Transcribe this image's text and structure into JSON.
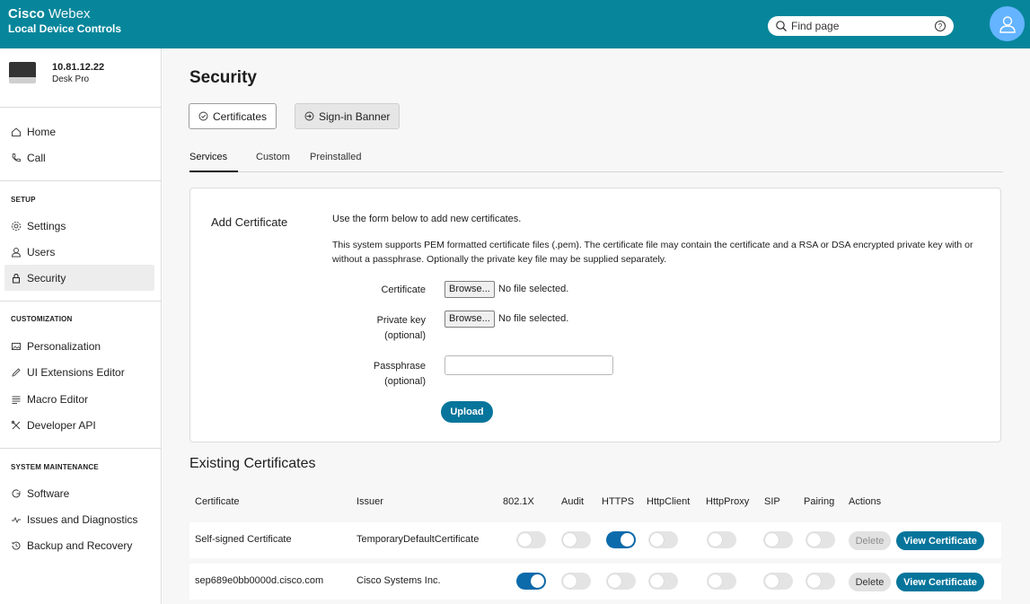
{
  "header": {
    "brand_bold": "Cisco",
    "brand_light": "Webex",
    "subtitle": "Local Device Controls",
    "search_placeholder": "Find page",
    "colors": {
      "bar": "#07869b",
      "avatar": "#64b4ff"
    }
  },
  "device": {
    "ip": "10.81.12.22",
    "model": "Desk Pro"
  },
  "sidebar": {
    "top": [
      {
        "label": "Home",
        "icon": "home-icon"
      },
      {
        "label": "Call",
        "icon": "phone-icon"
      }
    ],
    "sections": [
      {
        "title": "SETUP",
        "items": [
          {
            "label": "Settings",
            "icon": "gear-icon"
          },
          {
            "label": "Users",
            "icon": "user-icon"
          },
          {
            "label": "Security",
            "icon": "lock-icon",
            "active": true
          }
        ]
      },
      {
        "title": "CUSTOMIZATION",
        "items": [
          {
            "label": "Personalization",
            "icon": "image-icon"
          },
          {
            "label": "UI Extensions Editor",
            "icon": "pencil-icon"
          },
          {
            "label": "Macro Editor",
            "icon": "lines-icon"
          },
          {
            "label": "Developer API",
            "icon": "tools-icon"
          }
        ]
      },
      {
        "title": "SYSTEM MAINTENANCE",
        "items": [
          {
            "label": "Software",
            "icon": "refresh-icon"
          },
          {
            "label": "Issues and Diagnostics",
            "icon": "pulse-icon"
          },
          {
            "label": "Backup and Recovery",
            "icon": "history-icon"
          }
        ]
      }
    ]
  },
  "main": {
    "title": "Security",
    "tabs": [
      {
        "label": "Certificates",
        "active": true
      },
      {
        "label": "Sign-in Banner",
        "active": false
      }
    ],
    "subtabs": [
      {
        "label": "Services",
        "active": true
      },
      {
        "label": "Custom",
        "active": false
      },
      {
        "label": "Preinstalled",
        "active": false
      }
    ]
  },
  "add_cert": {
    "title": "Add Certificate",
    "desc1": "Use the form below to add new certificates.",
    "desc2": "This system supports PEM formatted certificate files (.pem). The certificate file may contain the certificate and a RSA or DSA encrypted private key with or without a passphrase. Optionally the private key file may be supplied separately.",
    "certificate_label": "Certificate",
    "private_key_label": "Private key",
    "private_key_sub": "(optional)",
    "passphrase_label": "Passphrase",
    "passphrase_sub": "(optional)",
    "browse_label": "Browse...",
    "no_file": "No file selected.",
    "passphrase_value": "",
    "upload_label": "Upload"
  },
  "existing": {
    "title": "Existing Certificates",
    "columns": [
      "Certificate",
      "Issuer",
      "802.1X",
      "Audit",
      "HTTPS",
      "HttpClient",
      "HttpProxy",
      "SIP",
      "Pairing",
      "Actions"
    ],
    "delete_label": "Delete",
    "view_label": "View Certificate",
    "rows": [
      {
        "certificate": "Self-signed Certificate",
        "issuer": "TemporaryDefaultCertificate",
        "toggles": [
          false,
          false,
          true,
          false,
          false,
          false,
          false
        ],
        "delete_enabled": false
      },
      {
        "certificate": "sep689e0bb0000d.cisco.com",
        "issuer": "Cisco Systems Inc.",
        "toggles": [
          true,
          false,
          false,
          false,
          false,
          false,
          false
        ],
        "delete_enabled": true
      }
    ]
  }
}
